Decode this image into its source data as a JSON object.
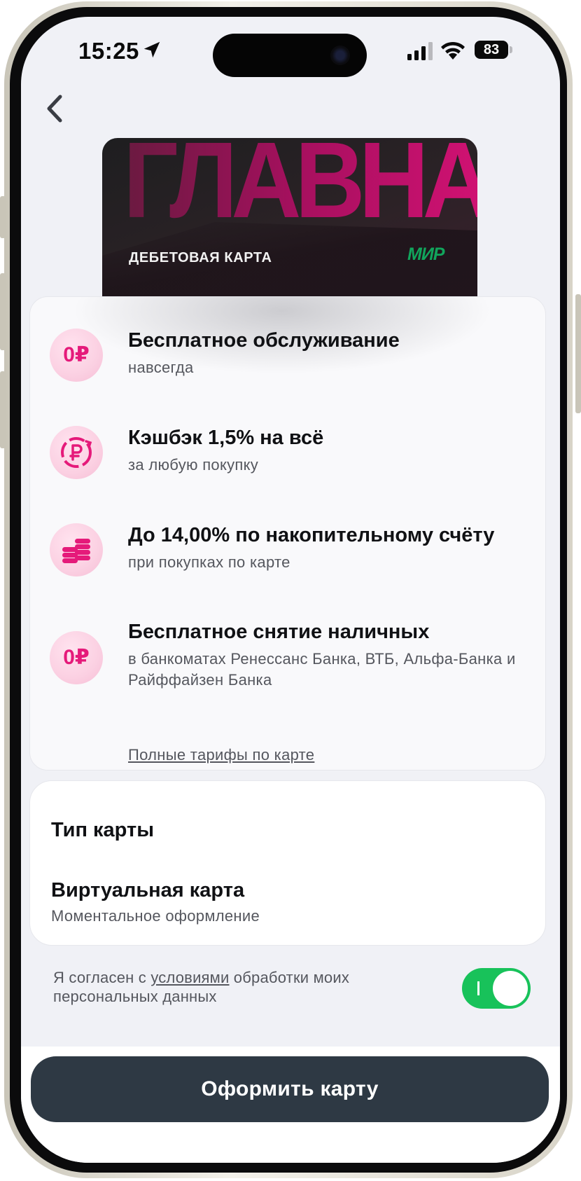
{
  "status_bar": {
    "time": "15:25",
    "battery": "83",
    "icons": [
      "location-arrow-icon",
      "cellular-signal-icon",
      "wifi-icon",
      "battery-icon"
    ]
  },
  "nav": {
    "back_icon": "chevron-left-icon"
  },
  "card": {
    "brand_text": "ГЛАВНАЯ",
    "type_label": "ДЕБЕТОВАЯ КАРТА",
    "payment_system": "МИР"
  },
  "features": [
    {
      "icon": "zero-ruble-icon",
      "icon_text": "0₽",
      "title": "Бесплатное обслуживание",
      "subtitle": "навсегда"
    },
    {
      "icon": "ruble-cashback-icon",
      "icon_text": "",
      "title": "Кэшбэк 1,5% на всё",
      "subtitle": "за любую покупку"
    },
    {
      "icon": "coins-stack-icon",
      "icon_text": "",
      "title": "До 14,00% по накопительному счёту",
      "subtitle": "при покупках по карте"
    },
    {
      "icon": "zero-ruble-icon",
      "icon_text": "0₽",
      "title": "Бесплатное снятие наличных",
      "subtitle": "в банкоматах Ренессанс Банка, ВТБ, Альфа-Банка и Райффайзен Банка"
    }
  ],
  "tariffs_link": "Полные тарифы по карте",
  "card_type": {
    "heading": "Тип карты",
    "name": "Виртуальная карта",
    "description": "Моментальное оформление"
  },
  "consent": {
    "prefix": "Я согласен с ",
    "link": "условиями",
    "suffix": " обработки моих персональных данных",
    "toggle_on": true
  },
  "cta": {
    "label": "Оформить карту"
  },
  "colors": {
    "accent_pink": "#e51a7a",
    "toggle_green": "#18c25a",
    "cta_bg": "#2e3944",
    "background": "#f0f1f6"
  }
}
